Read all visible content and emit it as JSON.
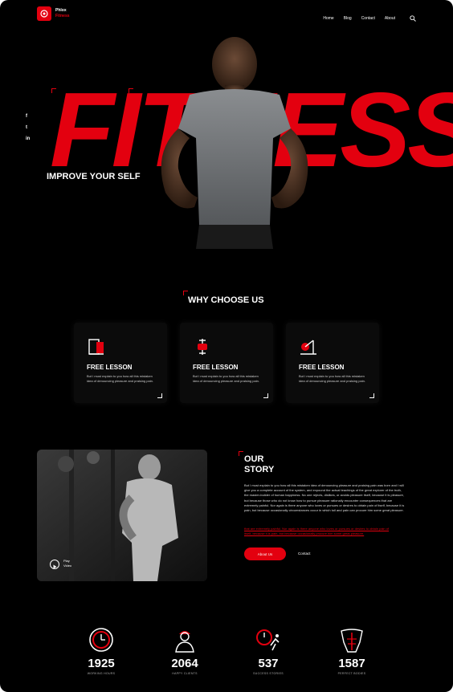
{
  "brand": {
    "line1": "Phlox",
    "line2": "Fitness",
    "accent": "#e3000f"
  },
  "nav": {
    "items": [
      "Home",
      "Blog",
      "Contact",
      "About"
    ]
  },
  "social": [
    "f",
    "t",
    "in"
  ],
  "hero": {
    "title": "FITNESS",
    "subtitle": "IMPROVE YOUR SELF"
  },
  "why": {
    "title": "WHY CHOOSE US",
    "cards": [
      {
        "title": "FREE LESSON",
        "text": "But I must explain to you how all this mistaken idea of denouncing pleasure and praising pain.",
        "icon": "treadmill-icon"
      },
      {
        "title": "FREE LESSON",
        "text": "But I must explain to you how all this mistaken idea of denouncing pleasure and praising pain.",
        "icon": "dumbbell-icon"
      },
      {
        "title": "FREE LESSON",
        "text": "But I must explain to you how all this mistaken idea of denouncing pleasure and praising pain.",
        "icon": "exercise-bike-icon"
      }
    ]
  },
  "story": {
    "title_line1": "OUR",
    "title_line2": "STORY",
    "text": "But I must explain to you how all this mistaken idea of denouncing pleasure and praising pain was born and I will give you a complete account of the system, and expound the actual teachings of the great explorer of the truth, the master-builder of human happiness. No one rejects, dislikes, or avoids pleasure itself, because it is pleasure, but because those who do not know how to pursue pleasure rationally encounter consequences that are extremely painful. Nor again is there anyone who loves or pursues or desires to obtain pain of itself, because it is pain, but because occasionally circumstances occur in which toil and pain can procure him some great pleasure.",
    "highlight": "that are extremely painful. Nor again is there anyone who loves or pursues or desires to obtain pain of itself, because it is pain, but because occasionally procure him some great pleasure.",
    "about_button": "About Us",
    "contact_link": "Contact",
    "video_label_line1": "Play",
    "video_label_line2": "Video"
  },
  "stats": [
    {
      "value": "1925",
      "label": "WORKING HOURS",
      "icon": "clock-icon"
    },
    {
      "value": "2064",
      "label": "HAPPY CLIENTS",
      "icon": "trainer-icon"
    },
    {
      "value": "537",
      "label": "SUCCESS STORIES",
      "icon": "stopwatch-runner-icon"
    },
    {
      "value": "1587",
      "label": "PERFECT BODIES",
      "icon": "muscle-torso-icon"
    }
  ]
}
